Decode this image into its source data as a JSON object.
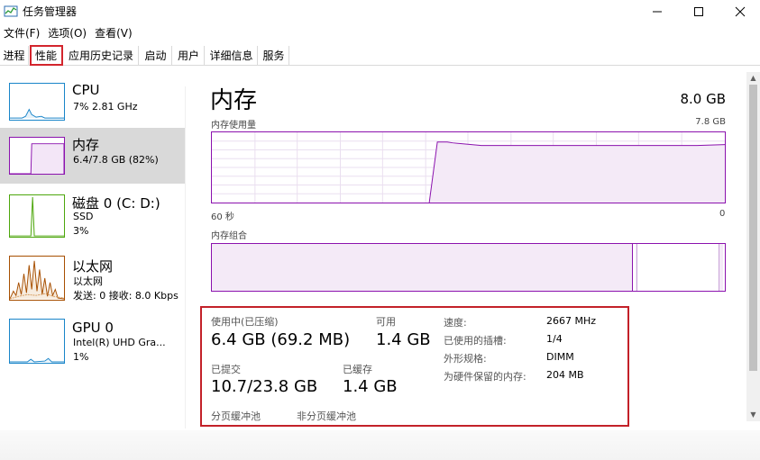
{
  "window": {
    "title": "任务管理器"
  },
  "menu": [
    "文件(F)",
    "选项(O)",
    "查看(V)"
  ],
  "tabs": [
    "进程",
    "性能",
    "应用历史记录",
    "启动",
    "用户",
    "详细信息",
    "服务"
  ],
  "active_tab": "性能",
  "sidebar": {
    "items": [
      {
        "title": "CPU",
        "sub1": "7%  2.81 GHz",
        "sub2": "",
        "sub3": "",
        "color": "#1985c9"
      },
      {
        "title": "内存",
        "sub1": "6.4/7.8 GB (82%)",
        "sub2": "",
        "sub3": "",
        "color": "#8b12ae"
      },
      {
        "title": "磁盘 0 (C: D:)",
        "sub1": "SSD",
        "sub2": "3%",
        "sub3": "",
        "color": "#4da60c"
      },
      {
        "title": "以太网",
        "sub1": "以太网",
        "sub2": "发送: 0  接收: 8.0 Kbps",
        "sub3": "",
        "color": "#a74f01"
      },
      {
        "title": "GPU 0",
        "sub1": "Intel(R) UHD Gra...",
        "sub2": "1%",
        "sub3": "",
        "color": "#1985c9"
      }
    ]
  },
  "main": {
    "title": "内存",
    "total": "8.0 GB",
    "usage_label": "内存使用量",
    "usage_max": "7.8 GB",
    "time_left": "60 秒",
    "time_right": "0",
    "composition_label": "内存组合",
    "accent": "#8b12ae"
  },
  "stats": {
    "in_use_label": "使用中(已压缩)",
    "in_use_value": "6.4 GB (69.2 MB)",
    "available_label": "可用",
    "available_value": "1.4 GB",
    "committed_label": "已提交",
    "committed_value": "10.7/23.8 GB",
    "cached_label": "已缓存",
    "cached_value": "1.4 GB",
    "paged_label": "分页缓冲池",
    "nonpaged_label": "非分页缓冲池",
    "speed_label": "速度:",
    "speed_value": "2667 MHz",
    "slots_label": "已使用的插槽:",
    "slots_value": "1/4",
    "form_label": "外形规格:",
    "form_value": "DIMM",
    "reserved_label": "为硬件保留的内存:",
    "reserved_value": "204 MB"
  }
}
